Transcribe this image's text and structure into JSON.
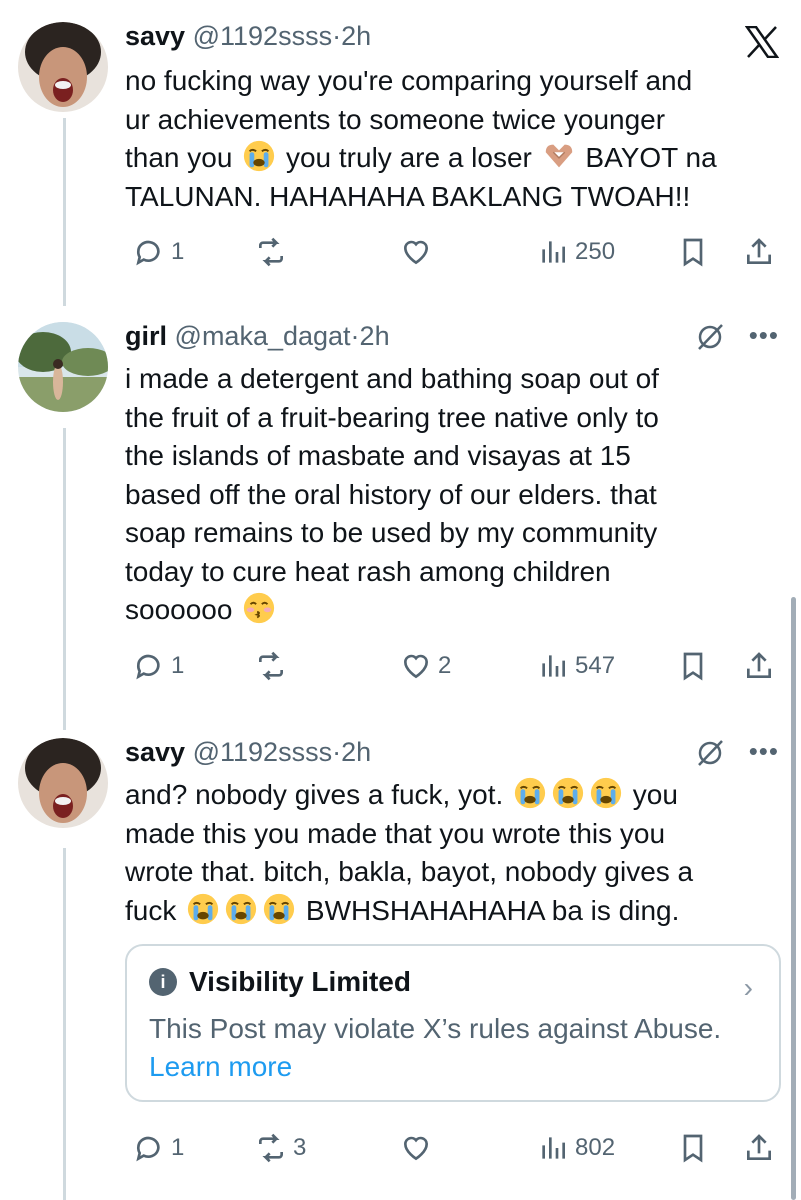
{
  "posts": [
    {
      "name": "savy",
      "handle": "@1192ssss",
      "dot": "·",
      "time": "2h",
      "lines": [
        "no fucking way you're comparing yourself and",
        "ur achievements to someone twice younger",
        [
          "than you ",
          "emoji:crying",
          " you truly are a loser ",
          "emoji:heart-hands",
          " BAYOT na"
        ],
        "TALUNAN. HAHAHAHA BAKLANG TWOAH!!"
      ],
      "replies": "1",
      "reposts": "",
      "likes": "",
      "views": "250",
      "top_icon": "x-logo-icon"
    },
    {
      "name": "girl",
      "handle": "@maka_dagat",
      "dot": "·",
      "time": "2h",
      "lines": [
        "i made a detergent and bathing soap out of",
        "the fruit of a fruit-bearing tree native only to",
        "the islands of masbate and visayas at 15",
        "based off the oral history of our elders. that",
        "soap remains to be used by my community",
        "today to cure heat rash among children",
        [
          "soooooo ",
          "emoji:kissing"
        ]
      ],
      "replies": "1",
      "reposts": "",
      "likes": "2",
      "views": "547"
    },
    {
      "name": "savy",
      "handle": "@1192ssss",
      "dot": "·",
      "time": "2h",
      "lines": [
        [
          "and? nobody gives a fuck, yot. ",
          "emoji:crying",
          "emoji:crying",
          "emoji:crying",
          " you"
        ],
        "made this you made that you wrote this you",
        "wrote that. bitch, bakla, bayot, nobody gives a",
        [
          "fuck ",
          "emoji:crying",
          "emoji:crying",
          "emoji:crying",
          " BWHSHAHAHAHA ba is ding."
        ]
      ],
      "visibility": {
        "title": "Visibility Limited",
        "text": "This Post may violate X’s rules against Abuse.",
        "link": "Learn more"
      },
      "replies": "1",
      "reposts": "3",
      "likes": "",
      "views": "802"
    }
  ],
  "colors": {
    "text": "#0f1419",
    "secondary": "#536471",
    "link": "#1d9bf0",
    "border": "#cfd9de"
  }
}
